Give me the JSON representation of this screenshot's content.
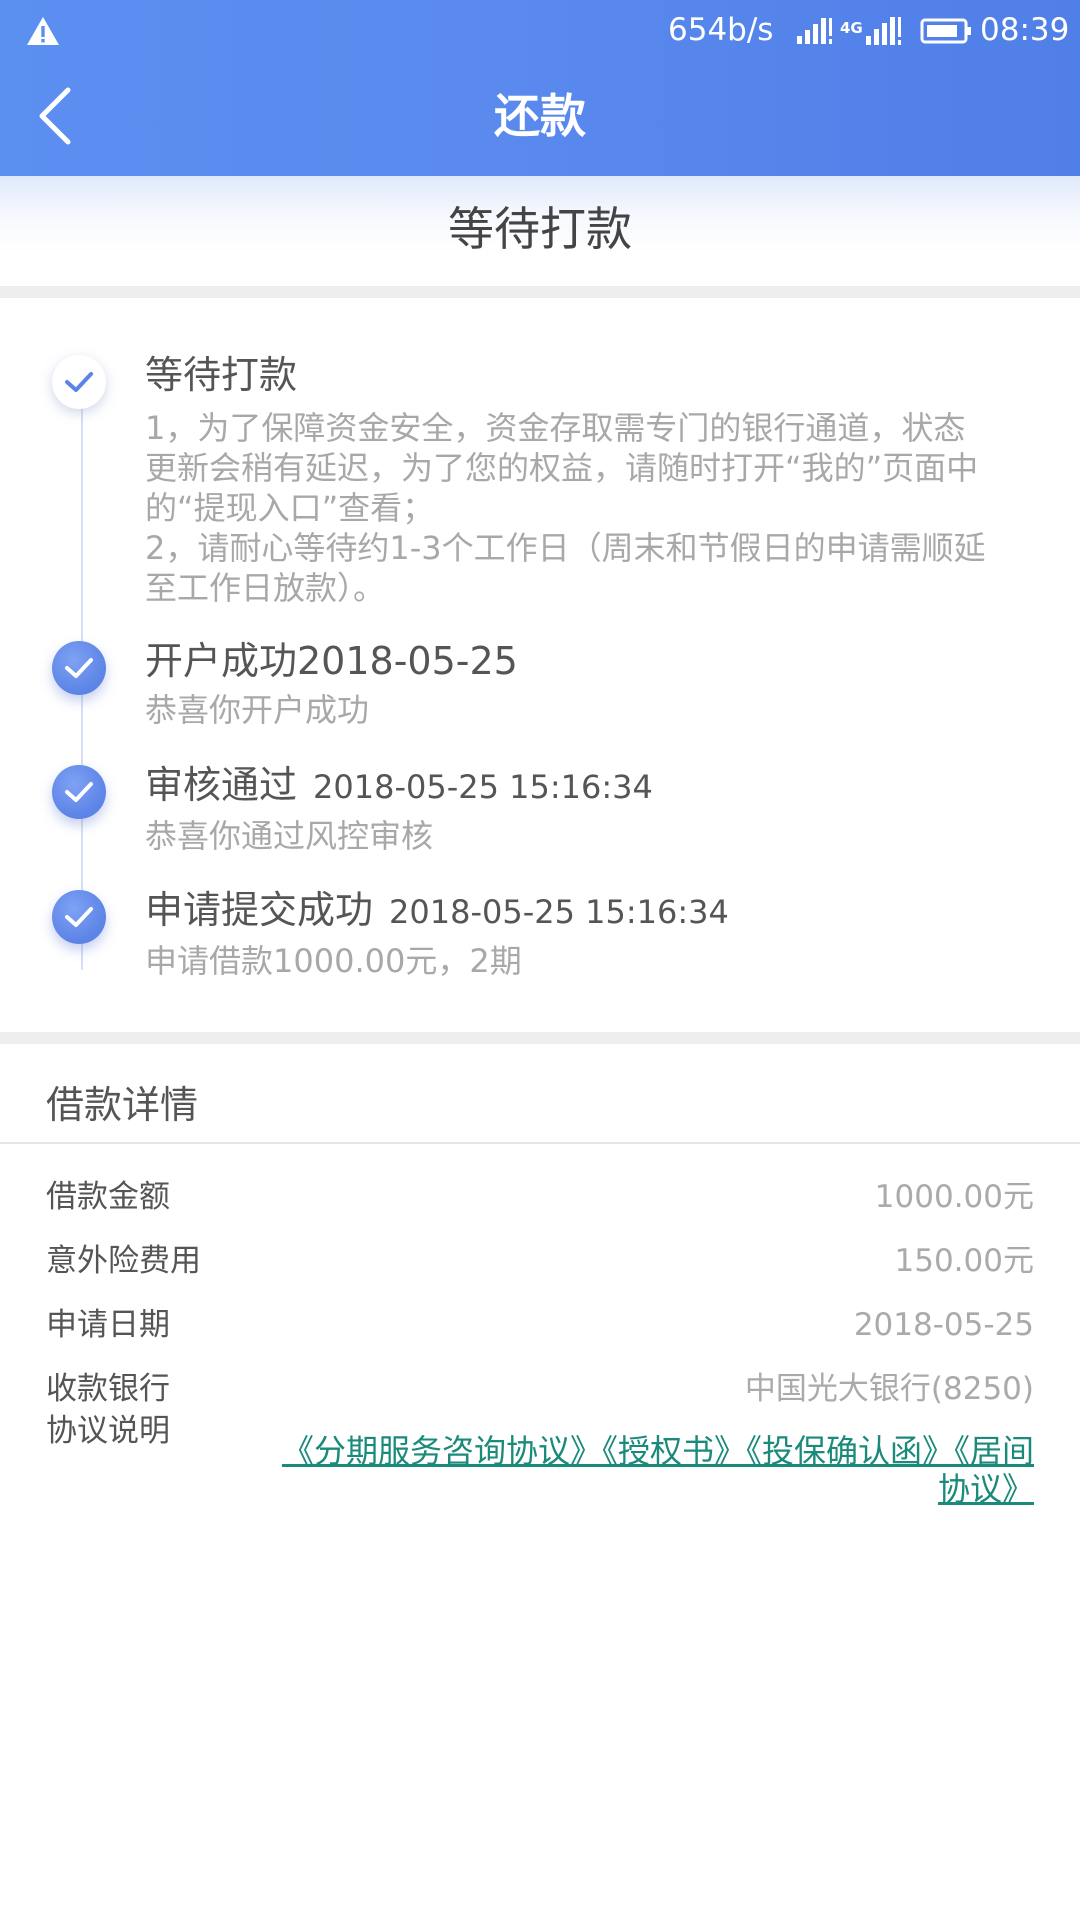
{
  "status_bar": {
    "net_speed": "654b/s",
    "network_type": "4G",
    "time": "08:39",
    "icons": [
      "warning-icon",
      "signal-icon",
      "lte-signal-icon",
      "battery-icon"
    ]
  },
  "nav": {
    "title": "还款",
    "back_icon": "chevron-left-icon"
  },
  "status_banner": "等待打款",
  "timeline": [
    {
      "state": "pending",
      "title": "等待打款",
      "time": "",
      "desc_lines": [
        "1，为了保障资金安全，资金存取需专门的银行通道，状态",
        "更新会稍有延迟，为了您的权益，请随时打开“我的”页面中",
        "的“提现入口”查看；",
        "2，请耐心等待约1-3个工作日（周末和节假日的申请需顺延",
        "至工作日放款）。"
      ]
    },
    {
      "state": "done",
      "title": "开户成功2018-05-25",
      "time": "",
      "desc": "恭喜你开户成功"
    },
    {
      "state": "done",
      "title": "审核通过",
      "time": "2018-05-25 15:16:34",
      "desc": "恭喜你通过风控审核"
    },
    {
      "state": "done",
      "title": "申请提交成功",
      "time": "2018-05-25 15:16:34",
      "desc": "申请借款1000.00元，2期"
    }
  ],
  "details": {
    "title": "借款详情",
    "rows": [
      {
        "label": "借款金额",
        "value": "1000.00元"
      },
      {
        "label": "意外险费用",
        "value": "150.00元"
      },
      {
        "label": "申请日期",
        "value": "2018-05-25"
      },
      {
        "label": "收款银行",
        "value": "中国光大银行(8250)"
      }
    ],
    "agreement_label": "协议说明",
    "agreements": [
      "《分期服务咨询协议》",
      "《授权书》",
      "《投保确认函》",
      "《居间协议》"
    ]
  },
  "colors": {
    "header_blue": "#5a8aee",
    "done_dot": "#5c83e6",
    "link_green": "#1a8a7a"
  }
}
